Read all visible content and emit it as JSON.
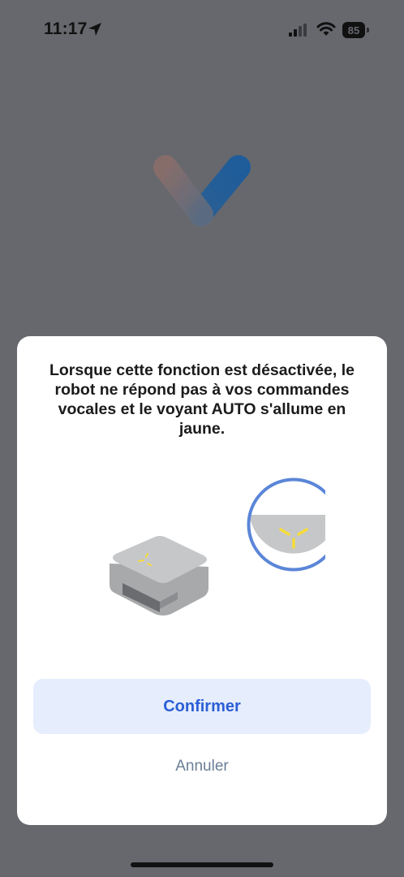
{
  "status_bar": {
    "time": "11:17",
    "battery_level": "85"
  },
  "dialog": {
    "message": "Lorsque cette fonction est désactivée, le robot ne répond pas à vos commandes vocales et le voyant AUTO s'allume en jaune.",
    "confirm_label": "Confirmer",
    "cancel_label": "Annuler"
  },
  "colors": {
    "overlay_background": "#66686d",
    "primary_accent": "#2b5fd6",
    "confirm_background": "#e6edfc",
    "led_yellow": "#f5dc3a"
  },
  "icons": [
    "location-arrow-icon",
    "cellular-signal-icon",
    "wifi-icon",
    "battery-icon",
    "app-logo",
    "robot-base-illustration"
  ]
}
